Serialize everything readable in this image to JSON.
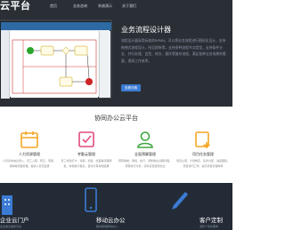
{
  "nav": {
    "logo": "云平台",
    "items": [
      "首页",
      "业务咨询",
      "系统演示",
      "关于我们"
    ]
  },
  "hero": {
    "title": "业务流程设计器",
    "description": "流程设计器采用标准的BPMN，可以将业务流程进行图形化设计，支持拖拽式流程设计，所见即所得，支持多种流程节点类型，支持条件分支、并行处理、会签、转办、委托等复杂流程，满足各种业务场景的需要，提高工作效率。",
    "button": "查看详情"
  },
  "section": {
    "title": "协同办公云平台"
  },
  "features": [
    {
      "icon": "calendar-icon",
      "label": "人力资源管理",
      "desc": "人员基本信息录入，员工入职、转正、离职、调岗等流程管理，提供人员花名册"
    },
    {
      "icon": "checkbox-icon",
      "label": "考勤云管理",
      "desc": "员工考勤打卡，请假、加班、出差等流程审批，考勤统计报表，自动计算考勤结果"
    },
    {
      "icon": "user-icon",
      "label": "全面预算管理",
      "desc": "预算编制、审批、执行、调整等全过程管理，预算执行分析，实时掌控费用支出"
    },
    {
      "icon": "plus-icon",
      "label": "项目任务管理",
      "desc": "项目立项、计划制定、任务分配、进度跟踪，项目协同工作，提高项目管理效率"
    }
  ],
  "bands": [
    {
      "title": "企业云门户",
      "sub": "企业信息发布平台"
    },
    {
      "title": "移动云办公",
      "sub": "随时随地移动办公"
    },
    {
      "title": "客户定制",
      "sub": "满足个性化需求"
    }
  ],
  "colors": {
    "dark": "#2a2f36",
    "accent": "#3b7bd4",
    "icon_orange": "#f5a623",
    "icon_pink": "#e04a7c",
    "icon_green": "#3fa63f"
  }
}
